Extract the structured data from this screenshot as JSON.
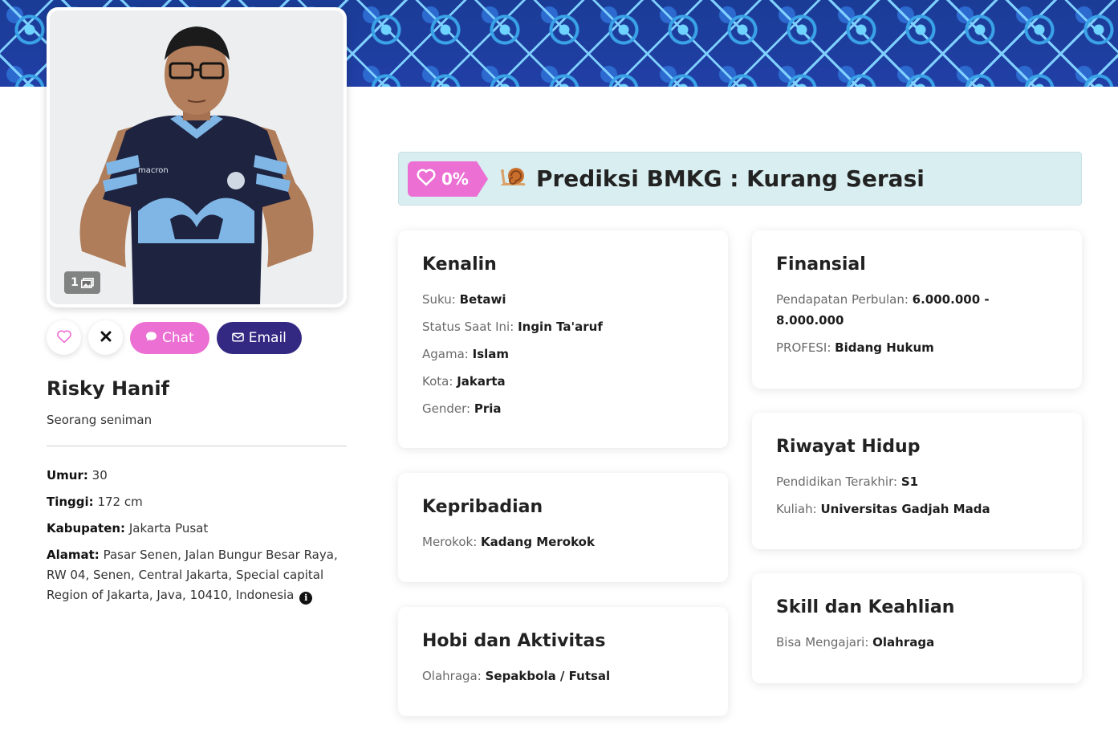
{
  "profile": {
    "photo_count": "1",
    "name": "Risky Hanif",
    "tagline": "Seorang seniman",
    "details": [
      {
        "label": "Umur:",
        "value": "30"
      },
      {
        "label": "Tinggi:",
        "value": "172 cm"
      },
      {
        "label": "Kabupaten:",
        "value": "Jakarta Pusat"
      },
      {
        "label": "Alamat:",
        "value": "Pasar Senen, Jalan Bungur Besar Raya, RW 04, Senen, Central Jakarta, Special capital Region of Jakarta, Java, 10410, Indonesia"
      }
    ]
  },
  "actions": {
    "chat_label": "Chat",
    "email_label": "Email"
  },
  "match": {
    "percent": "0%",
    "prediction": "Prediksi BMKG : Kurang Serasi"
  },
  "cards": {
    "kenalin": {
      "title": "Kenalin",
      "fields": [
        {
          "label": "Suku:",
          "value": "Betawi"
        },
        {
          "label": "Status Saat Ini:",
          "value": "Ingin Ta'aruf"
        },
        {
          "label": "Agama:",
          "value": "Islam"
        },
        {
          "label": "Kota:",
          "value": "Jakarta"
        },
        {
          "label": "Gender:",
          "value": "Pria"
        }
      ]
    },
    "kepribadian": {
      "title": "Kepribadian",
      "fields": [
        {
          "label": "Merokok:",
          "value": "Kadang Merokok"
        }
      ]
    },
    "hobi": {
      "title": "Hobi dan Aktivitas",
      "fields": [
        {
          "label": "Olahraga:",
          "value": "Sepakbola / Futsal"
        }
      ]
    },
    "finansial": {
      "title": "Finansial",
      "fields": [
        {
          "label": "Pendapatan Perbulan:",
          "value": "6.000.000 - 8.000.000"
        },
        {
          "label": "PROFESI:",
          "value": "Bidang Hukum"
        }
      ]
    },
    "riwayat": {
      "title": "Riwayat Hidup",
      "fields": [
        {
          "label": "Pendidikan Terakhir:",
          "value": "S1"
        },
        {
          "label": "Kuliah:",
          "value": "Universitas Gadjah Mada"
        }
      ]
    },
    "skill": {
      "title": "Skill dan Keahlian",
      "fields": [
        {
          "label": "Bisa Mengajari:",
          "value": "Olahraga"
        }
      ]
    }
  },
  "colors": {
    "accent_pink": "#ec6fd3",
    "accent_navy": "#332983",
    "match_bg": "#d9eef0"
  },
  "icons": [
    "heart-icon",
    "close-icon",
    "chat-icon",
    "envelope-icon",
    "gallery-icon",
    "snail-icon",
    "info-icon"
  ]
}
